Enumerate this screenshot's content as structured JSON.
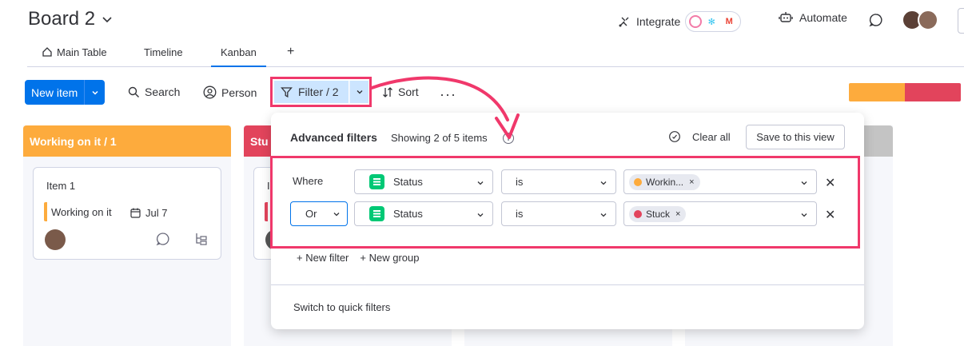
{
  "header": {
    "board_title": "Board 2",
    "integrate_label": "Integrate",
    "automate_label": "Automate"
  },
  "tabs": [
    {
      "label": "Main Table"
    },
    {
      "label": "Timeline"
    },
    {
      "label": "Kanban"
    },
    {
      "label": "+"
    }
  ],
  "toolbar": {
    "new_item_label": "New item",
    "search_label": "Search",
    "person_label": "Person",
    "filter_label": "Filter / 2",
    "sort_label": "Sort",
    "more_label": "···"
  },
  "status_progress": [
    {
      "color": "#fdab3d",
      "fraction": 0.5
    },
    {
      "color": "#e2445c",
      "fraction": 0.5
    }
  ],
  "columns": [
    {
      "title": "Working on it / 1",
      "color": "#fdab3d"
    },
    {
      "title": "Stu",
      "color": "#e2445c"
    },
    {
      "title": "",
      "color": "#c4c4c4"
    }
  ],
  "card": {
    "title": "Item 1",
    "status": "Working on it",
    "date": "Jul 7",
    "second_card_title_fragment": "I"
  },
  "filter_panel": {
    "title": "Advanced filters",
    "count_text": "Showing 2 of 5 items",
    "info_glyph": "i",
    "clear_all_label": "Clear all",
    "save_view_label": "Save to this view",
    "rows": [
      {
        "connector": "Where",
        "column": "Status",
        "operator": "is",
        "value": "Workin...",
        "value_color": "#fdab3d"
      },
      {
        "connector": "Or",
        "column": "Status",
        "operator": "is",
        "value": "Stuck",
        "value_color": "#e2445c"
      }
    ],
    "new_filter_label": "+ New filter",
    "new_group_label": "+ New group",
    "switch_label": "Switch to quick filters"
  },
  "colors": {
    "primary": "#0073ea",
    "highlight": "#f0386b",
    "filter_bg": "#cce5ff",
    "status_green": "#00c875"
  }
}
